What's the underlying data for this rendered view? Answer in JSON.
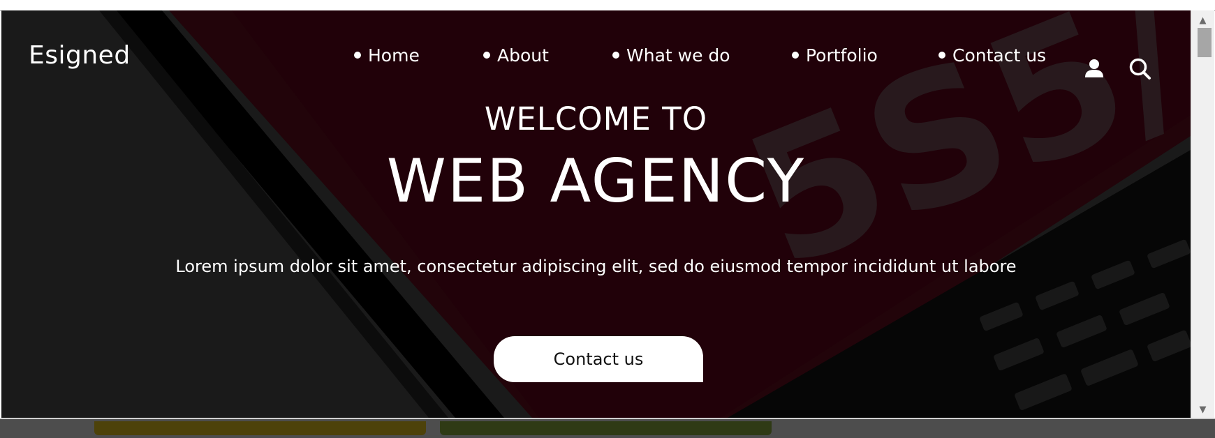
{
  "brand": {
    "logo": "Esigned"
  },
  "nav": {
    "items": [
      {
        "label": "Home"
      },
      {
        "label": "About"
      },
      {
        "label": "What we do"
      },
      {
        "label": "Portfolio"
      },
      {
        "label": "Contact us"
      }
    ],
    "icons": [
      "user-icon",
      "search-icon"
    ]
  },
  "hero": {
    "welcome": "WELCOME TO",
    "title": "WEB AGENCY",
    "subtitle": "Lorem ipsum dolor sit amet, consectetur adipiscing elit, sed do eiusmod tempor incididunt ut labore",
    "cta_label": "Contact us",
    "background_art_text": "5S5/"
  },
  "colors": {
    "hero_overlay": "#1c1c1c",
    "hero_red": "#2a0005",
    "text": "#ffffff",
    "cta_bg": "#ffffff",
    "cta_text": "#111111"
  }
}
